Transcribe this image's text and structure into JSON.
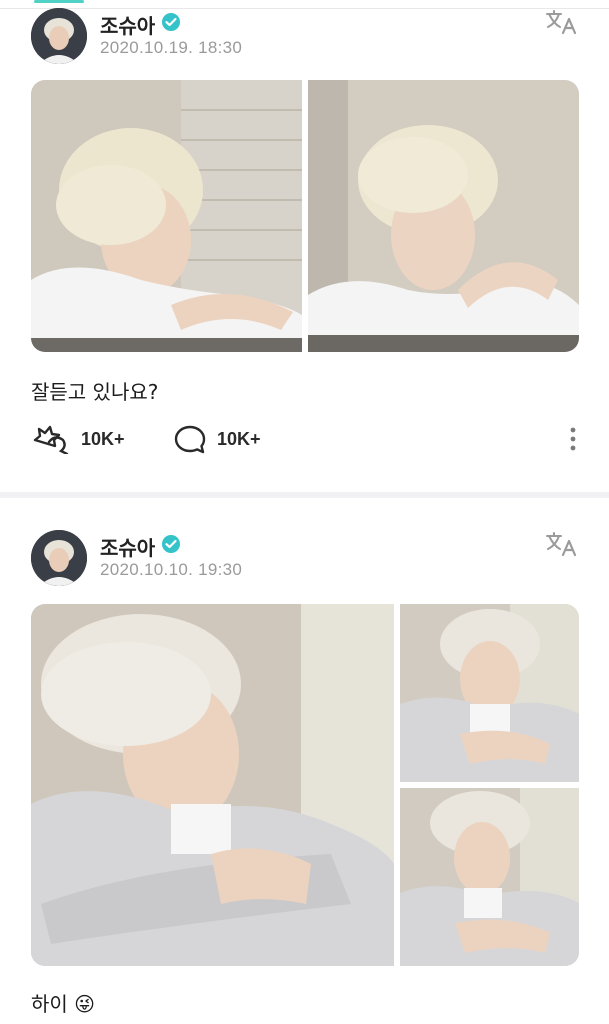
{
  "colors": {
    "accent": "#4fd1c5",
    "verified": "#34c3c9",
    "muted": "#9a9a9a"
  },
  "posts": [
    {
      "author": "조슈아",
      "date": "2020.10.19. 18:30",
      "text": "잘듣고 있나요?",
      "photo_count": 2,
      "likes": "10K+",
      "comments": "10K+"
    },
    {
      "author": "조슈아",
      "date": "2020.10.10. 19:30",
      "text": "하이 😜",
      "photo_count": 3
    }
  ],
  "icons": {
    "verified": "verified-badge-icon",
    "translate": "translate-icon",
    "like": "like-icon",
    "comment": "comment-icon",
    "more": "more-vertical-icon"
  }
}
